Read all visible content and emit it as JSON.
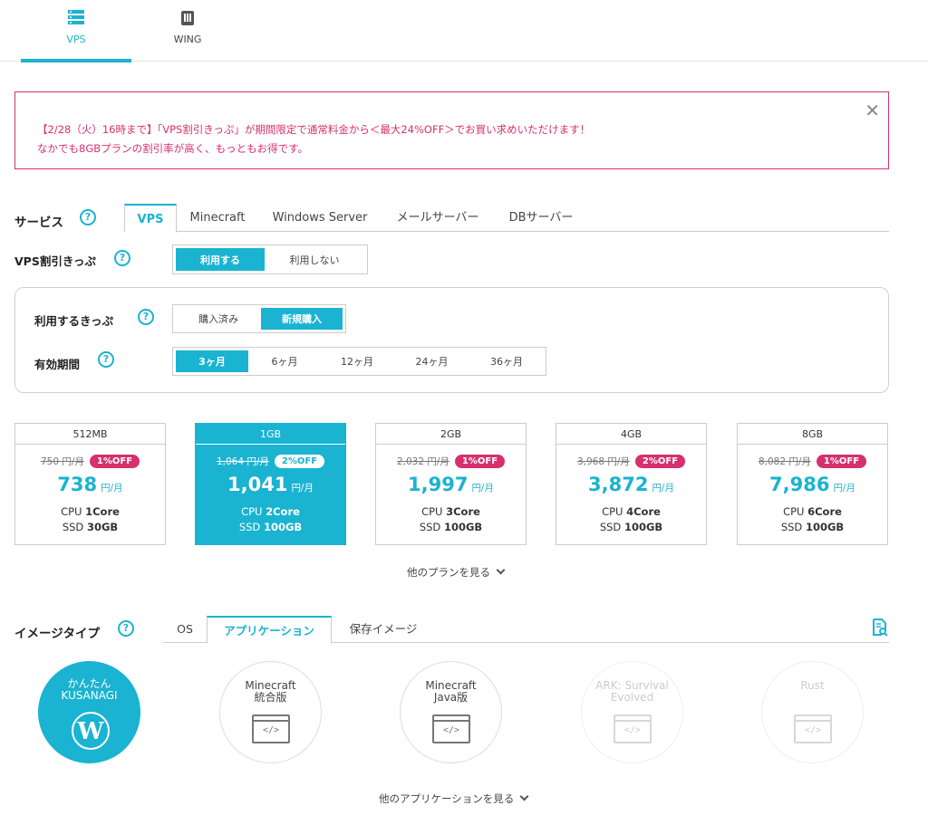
{
  "colors": {
    "accent": "#1ab3d1",
    "discount": "#d6306e"
  },
  "nav": {
    "items": [
      {
        "label": "VPS",
        "icon": "server-icon"
      },
      {
        "label": "WING",
        "icon": "storage-icon"
      }
    ]
  },
  "banner": {
    "line1": "【2/28（火）16時まで】「VPS割引きっぷ」が期間限定で通常料金から＜最大24%OFF＞でお買い求めいただけます！",
    "line2": "なかでも8GBプランの割引率が高く、もっともお得です。",
    "close": "✕"
  },
  "service": {
    "label": "サービス",
    "tabs": [
      "VPS",
      "Minecraft",
      "Windows Server",
      "メールサーバー",
      "DBサーバー"
    ],
    "active_tab": "VPS"
  },
  "ticket": {
    "label": "VPS割引きっぷ",
    "options": [
      "利用する",
      "利用しない"
    ],
    "selected": "利用する"
  },
  "coupon": {
    "label": "利用するきっぷ",
    "options": [
      "購入済み",
      "新規購入"
    ],
    "selected": "新規購入"
  },
  "period": {
    "label": "有効期間",
    "options": [
      "3ヶ月",
      "6ヶ月",
      "12ヶ月",
      "24ヶ月",
      "36ヶ月"
    ],
    "selected": "3ヶ月"
  },
  "plans": [
    {
      "name": "512MB",
      "old": "750 円/月",
      "badge": "1%OFF",
      "price": "738",
      "unit": "円/月",
      "cpu_label": "CPU ",
      "cpu": "1Core",
      "ssd_label": "SSD ",
      "ssd": "30GB"
    },
    {
      "name": "1GB",
      "old": "1,064 円/月",
      "badge": "2%OFF",
      "price": "1,041",
      "unit": "円/月",
      "cpu_label": "CPU ",
      "cpu": "2Core",
      "ssd_label": "SSD ",
      "ssd": "100GB"
    },
    {
      "name": "2GB",
      "old": "2,032 円/月",
      "badge": "1%OFF",
      "price": "1,997",
      "unit": "円/月",
      "cpu_label": "CPU ",
      "cpu": "3Core",
      "ssd_label": "SSD ",
      "ssd": "100GB"
    },
    {
      "name": "4GB",
      "old": "3,968 円/月",
      "badge": "2%OFF",
      "price": "3,872",
      "unit": "円/月",
      "cpu_label": "CPU ",
      "cpu": "4Core",
      "ssd_label": "SSD ",
      "ssd": "100GB"
    },
    {
      "name": "8GB",
      "old": "8,082 円/月",
      "badge": "1%OFF",
      "price": "7,986",
      "unit": "円/月",
      "cpu_label": "CPU ",
      "cpu": "6Core",
      "ssd_label": "SSD ",
      "ssd": "100GB"
    }
  ],
  "selected_plan": "1GB",
  "more_plans": "他のプランを見る",
  "image_type": {
    "label": "イメージタイプ",
    "tabs": [
      "OS",
      "アプリケーション",
      "保存イメージ"
    ],
    "active_tab": "アプリケーション",
    "search_icon": "document-search-icon"
  },
  "apps": [
    {
      "line1": "かんたん",
      "line2": "KUSANAGI",
      "icon": "wordpress-icon",
      "state": "selected"
    },
    {
      "line1": "Minecraft",
      "line2": "統合版",
      "icon": "code-window-icon",
      "state": "enabled"
    },
    {
      "line1": "Minecraft",
      "line2": "Java版",
      "icon": "code-window-icon",
      "state": "enabled"
    },
    {
      "line1": "ARK: Survival",
      "line2": "Evolved",
      "icon": "code-window-icon",
      "state": "disabled"
    },
    {
      "line1": "Rust",
      "line2": "",
      "icon": "code-window-icon",
      "state": "disabled"
    }
  ],
  "more_apps": "他のアプリケーションを見る"
}
